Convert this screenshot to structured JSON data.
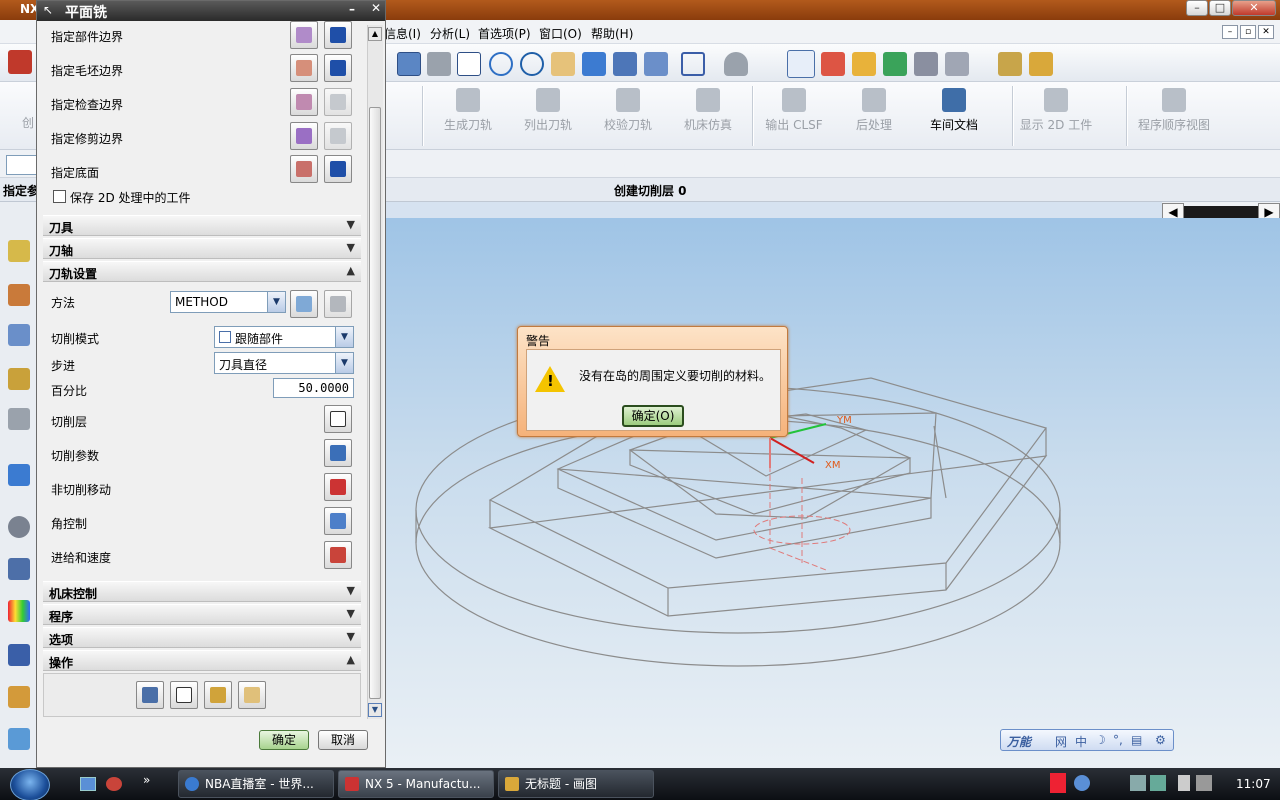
{
  "app": {
    "title_short": "NX"
  },
  "menu": {
    "items": [
      "信息(I)",
      "分析(L)",
      "首选项(P)",
      "窗口(O)",
      "帮助(H)"
    ]
  },
  "toolbar2": {
    "buttons": [
      {
        "label": "生成刀轨",
        "enabled": false
      },
      {
        "label": "列出刀轨",
        "enabled": false
      },
      {
        "label": "校验刀轨",
        "enabled": false
      },
      {
        "label": "机床仿真",
        "enabled": false
      },
      {
        "label": "输出 CLSF",
        "enabled": false
      },
      {
        "label": "后处理",
        "enabled": false
      },
      {
        "label": "车间文档",
        "enabled": true
      },
      {
        "label": "显示 2D 工件",
        "enabled": false
      },
      {
        "label": "程序顺序视图",
        "enabled": false
      }
    ],
    "left_partial": "创"
  },
  "row4": {
    "left_partial": "指定参",
    "cut_layer": "创建切削层 0"
  },
  "dialog": {
    "title": "平面铣",
    "boundaries": [
      "指定部件边界",
      "指定毛坯边界",
      "指定检查边界",
      "指定修剪边界",
      "指定底面"
    ],
    "save_2d_label": "保存 2D 处理中的工件",
    "sections_top": [
      "刀具",
      "刀轴",
      "刀轨设置"
    ],
    "method_label": "方法",
    "method_value": "METHOD",
    "cut_mode_label": "切削模式",
    "cut_mode_value": "跟随部件",
    "stepover_label": "步进",
    "stepover_value": "刀具直径",
    "percent_label": "百分比",
    "percent_value": "50.0000",
    "settings": [
      "切削层",
      "切削参数",
      "非切削移动",
      "角控制",
      "进给和速度"
    ],
    "sections_bottom": [
      "机床控制",
      "程序",
      "选项",
      "操作"
    ],
    "ok_label": "确定",
    "cancel_label": "取消"
  },
  "warning": {
    "title": "警告",
    "message": "没有在岛的周围定义要切削的材料。",
    "ok_label": "确定(O)"
  },
  "axes": {
    "xm": "XM",
    "ym": "YM"
  },
  "ime": {
    "label": "万能",
    "items": [
      "网",
      "中"
    ]
  },
  "taskbar": {
    "tasks": [
      "NBA直播室 - 世界...",
      "NX 5 - Manufactu...",
      "无标题 - 画图"
    ],
    "clock": "11:07"
  },
  "colors": {
    "accent": "#3f6ea8",
    "title_bar": "#9a4714",
    "warning_frame": "#f5b27a"
  }
}
